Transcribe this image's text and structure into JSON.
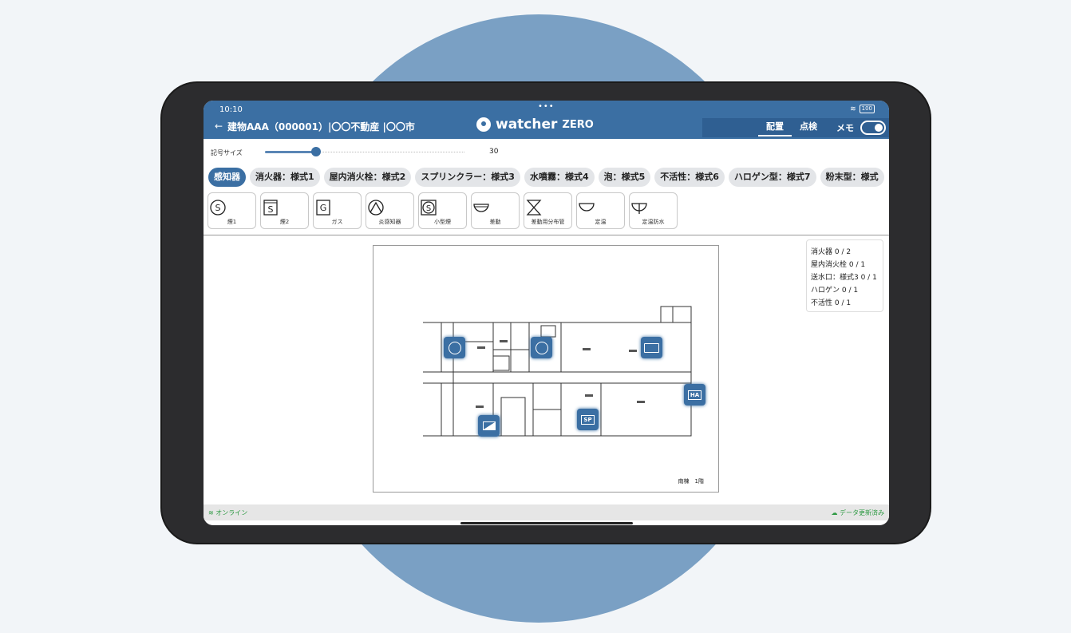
{
  "status": {
    "time": "10:10",
    "battery": "100"
  },
  "header": {
    "back_icon": "arrow-left-icon",
    "breadcrumb": "建物AAA（000001）|〇〇不動産 |〇〇市",
    "logo": "watcher",
    "logo_suffix": "ZERO",
    "tabs": [
      {
        "label": "配置",
        "active": true
      },
      {
        "label": "点検",
        "active": false
      }
    ],
    "memo_label": "メモ",
    "memo_toggle_on": true
  },
  "symbol_size": {
    "label": "記号サイズ",
    "value": "30"
  },
  "categories": [
    {
      "label": "感知器",
      "active": true
    },
    {
      "label": "消火器：様式1"
    },
    {
      "label": "屋内消火栓：様式2"
    },
    {
      "label": "スプリンクラー：様式3"
    },
    {
      "label": "水噴霧：様式4"
    },
    {
      "label": "泡：様式5"
    },
    {
      "label": "不活性：様式6"
    },
    {
      "label": "ハロゲン型：様式7"
    },
    {
      "label": "粉末型：様式"
    }
  ],
  "symbols": [
    {
      "label": "煙1",
      "icon": "smoke-detector-1-icon"
    },
    {
      "label": "煙2",
      "icon": "smoke-detector-2-icon"
    },
    {
      "label": "ガス",
      "icon": "gas-detector-icon"
    },
    {
      "label": "炎感知器",
      "icon": "flame-detector-icon"
    },
    {
      "label": "小型煙",
      "icon": "small-smoke-detector-icon"
    },
    {
      "label": "差動",
      "icon": "differential-detector-icon"
    },
    {
      "label": "差動用分布管",
      "icon": "distribution-tube-icon"
    },
    {
      "label": "定温",
      "icon": "fixed-temperature-icon"
    },
    {
      "label": "定温防水",
      "icon": "waterproof-fixed-temperature-icon"
    }
  ],
  "floorplan": {
    "caption": "南棟　1階",
    "markers": [
      {
        "type": "circle",
        "label": ""
      },
      {
        "type": "circle",
        "label": ""
      },
      {
        "type": "rect",
        "label": ""
      },
      {
        "type": "text",
        "label": "HA"
      },
      {
        "type": "text",
        "label": "SP"
      },
      {
        "type": "diag",
        "label": ""
      }
    ]
  },
  "counts": [
    "消火器 0 / 2",
    "屋内消火栓 0 / 1",
    "送水口：様式3 0 / 1",
    "ハロゲン 0 / 1",
    "不活性 0 / 1"
  ],
  "footer": {
    "online": "オンライン",
    "updated": "データ更新済み"
  },
  "colors": {
    "primary": "#3b6fa3",
    "background_circle": "#7aa0c4",
    "online": "#2f9a44"
  }
}
